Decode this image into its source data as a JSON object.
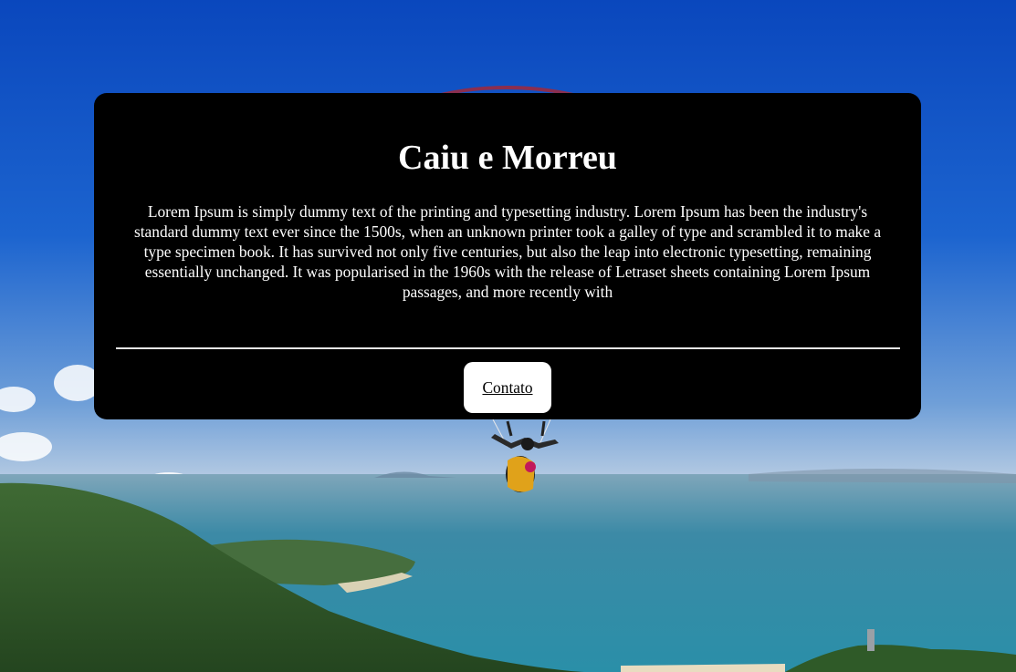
{
  "background": {
    "description_icon": "paraglider-over-coast-photo"
  },
  "card": {
    "title": "Caiu e Morreu",
    "text": "Lorem Ipsum is simply dummy text of the printing and typesetting industry. Lorem Ipsum has been the industry's standard dummy text ever since the 1500s, when an unknown printer took a galley of type and scrambled it to make a type specimen book. It has survived not only five centuries, but also the leap into electronic typesetting, remaining essentially unchanged. It was popularised in the 1960s with the release of Letraset sheets containing Lorem Ipsum passages, and more recently with",
    "contact_label": "Contato"
  },
  "colors": {
    "card_background": "#000000",
    "card_text": "#ffffff",
    "button_background": "#ffffff",
    "link_text": "#000000",
    "sky_top": "#0a4fc4",
    "sea": "#3a8fa8"
  }
}
